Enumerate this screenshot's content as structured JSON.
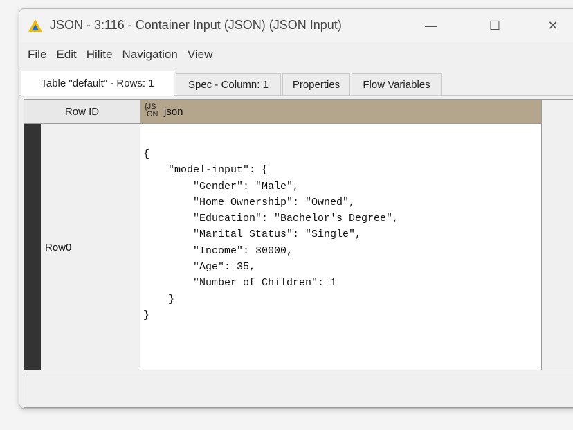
{
  "window": {
    "title": "JSON - 3:116 - Container Input (JSON) (JSON Input)",
    "controls": {
      "minimize": "—",
      "maximize": "☐",
      "close": "✕"
    }
  },
  "menu": [
    "File",
    "Edit",
    "Hilite",
    "Navigation",
    "View"
  ],
  "tabs": [
    {
      "label": "Table \"default\" - Rows: 1",
      "active": true
    },
    {
      "label": "Spec - Column: 1",
      "active": false
    },
    {
      "label": "Properties",
      "active": false
    },
    {
      "label": "Flow Variables",
      "active": false
    }
  ],
  "table": {
    "row_id_header": "Row ID",
    "column": {
      "type_icon_top": "{JS",
      "type_icon_bottom": "ON",
      "name": "json"
    },
    "rows": [
      {
        "id": "Row0",
        "json": "{\n    \"model-input\": {\n        \"Gender\": \"Male\",\n        \"Home Ownership\": \"Owned\",\n        \"Education\": \"Bachelor's Degree\",\n        \"Marital Status\": \"Single\",\n        \"Income\": 30000,\n        \"Age\": 35,\n        \"Number of Children\": 1\n    }\n}"
      }
    ]
  },
  "colors": {
    "column_header": "#b3a68d",
    "row_marker": "#333333",
    "warning_icon": "#f5b800"
  }
}
